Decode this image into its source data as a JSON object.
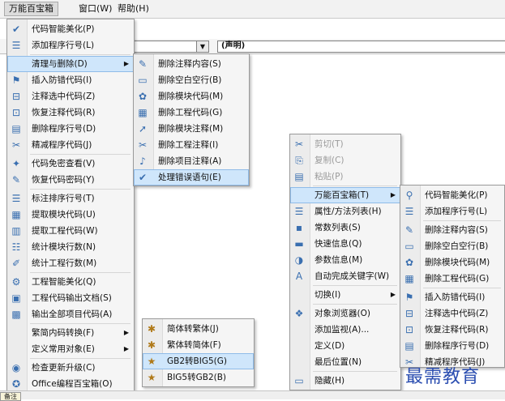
{
  "menubar": {
    "items": [
      {
        "label": "万能百宝箱",
        "active": true
      },
      {
        "label": "窗口(W)",
        "active": false
      },
      {
        "label": "帮助(H)",
        "active": false
      }
    ]
  },
  "toolbar": {
    "combo_value": "(声明)"
  },
  "main_menu": {
    "items": [
      {
        "icon": "✔",
        "label": "代码智能美化(P)"
      },
      {
        "icon": "☰",
        "label": "添加程序行号(L)"
      },
      {
        "icon": "",
        "label": "清理与删除(D)",
        "submenu": true
      },
      {
        "icon": "⚑",
        "label": "插入防错代码(I)"
      },
      {
        "icon": "⊟",
        "label": "注释选中代码(Z)"
      },
      {
        "icon": "⊡",
        "label": "恢复注释代码(R)"
      },
      {
        "icon": "▤",
        "label": "删除程序行号(D)"
      },
      {
        "icon": "✂",
        "label": "精减程序代码(J)"
      },
      {
        "icon": "✦",
        "label": "代码免密查看(V)"
      },
      {
        "icon": "✎",
        "label": "恢复代码密码(Y)"
      },
      {
        "icon": "☰",
        "label": "标注排序行号(T)"
      },
      {
        "icon": "▦",
        "label": "提取模块代码(U)"
      },
      {
        "icon": "▥",
        "label": "提取工程代码(W)"
      },
      {
        "icon": "☷",
        "label": "统计模块行数(N)"
      },
      {
        "icon": "✐",
        "label": "统计工程行数(M)"
      },
      {
        "icon": "⚙",
        "label": "工程智能美化(Q)"
      },
      {
        "icon": "▣",
        "label": "工程代码输出文档(S)"
      },
      {
        "icon": "▩",
        "label": "输出全部项目代码(A)"
      },
      {
        "icon": "",
        "label": "繁简内码转换(F)",
        "submenu": true
      },
      {
        "icon": "",
        "label": "定义常用对象(E)",
        "submenu": true
      },
      {
        "icon": "◉",
        "label": "检查更新升级(C)"
      },
      {
        "icon": "✪",
        "label": "Office编程百宝箱(O)"
      }
    ]
  },
  "clean_submenu": {
    "items": [
      {
        "icon": "✎",
        "label": "删除注释内容(S)"
      },
      {
        "icon": "▭",
        "label": "删除空白空行(B)"
      },
      {
        "icon": "✿",
        "label": "删除模块代码(M)"
      },
      {
        "icon": "▦",
        "label": "删除工程代码(G)"
      },
      {
        "icon": "➚",
        "label": "删除模块注释(M)"
      },
      {
        "icon": "✂",
        "label": "删除工程注释(I)"
      },
      {
        "icon": "♪",
        "label": "删除项目注释(A)"
      },
      {
        "icon": "✔",
        "label": "处理错误语句(E)"
      }
    ]
  },
  "convert_submenu": {
    "items": [
      {
        "icon": "✱",
        "label": "简体转繁体(J)"
      },
      {
        "icon": "✱",
        "label": "繁体转简体(F)"
      },
      {
        "icon": "★",
        "label": "GB2转BIG5(G)"
      },
      {
        "icon": "★",
        "label": "BIG5转GB2(B)"
      }
    ]
  },
  "context_menu": {
    "items": [
      {
        "icon": "✂",
        "label": "剪切(T)",
        "disabled": true
      },
      {
        "icon": "⎘",
        "label": "复制(C)",
        "disabled": true
      },
      {
        "icon": "▤",
        "label": "粘贴(P)",
        "disabled": true
      },
      {
        "icon": "",
        "label": "万能百宝箱(T)",
        "submenu": true
      },
      {
        "icon": "☰",
        "label": "属性/方法列表(H)"
      },
      {
        "icon": "▪",
        "label": "常数列表(S)"
      },
      {
        "icon": "▬",
        "label": "快速信息(Q)"
      },
      {
        "icon": "◑",
        "label": "参数信息(M)"
      },
      {
        "icon": "A",
        "label": "自动完成关键字(W)"
      },
      {
        "icon": "",
        "label": "切换(I)",
        "submenu": true
      },
      {
        "icon": "❖",
        "label": "对象浏览器(O)"
      },
      {
        "icon": "",
        "label": "添加监视(A)..."
      },
      {
        "icon": "",
        "label": "定义(D)"
      },
      {
        "icon": "",
        "label": "最后位置(N)"
      },
      {
        "icon": "▭",
        "label": "隐藏(H)"
      }
    ]
  },
  "context_submenu": {
    "items": [
      {
        "icon": "⚲",
        "label": "代码智能美化(P)"
      },
      {
        "icon": "☰",
        "label": "添加程序行号(L)"
      },
      {
        "icon": "✎",
        "label": "删除注释内容(S)"
      },
      {
        "icon": "▭",
        "label": "删除空白空行(B)"
      },
      {
        "icon": "✿",
        "label": "删除模块代码(M)"
      },
      {
        "icon": "▦",
        "label": "删除工程代码(G)"
      },
      {
        "icon": "⚑",
        "label": "插入防错代码(I)"
      },
      {
        "icon": "⊟",
        "label": "注释选中代码(Z)"
      },
      {
        "icon": "⊡",
        "label": "恢复注释代码(R)"
      },
      {
        "icon": "▤",
        "label": "删除程序行号(D)"
      },
      {
        "icon": "✂",
        "label": "精减程序代码(J)"
      }
    ]
  },
  "watermark": "最需教育",
  "bottom_tab": "备注"
}
